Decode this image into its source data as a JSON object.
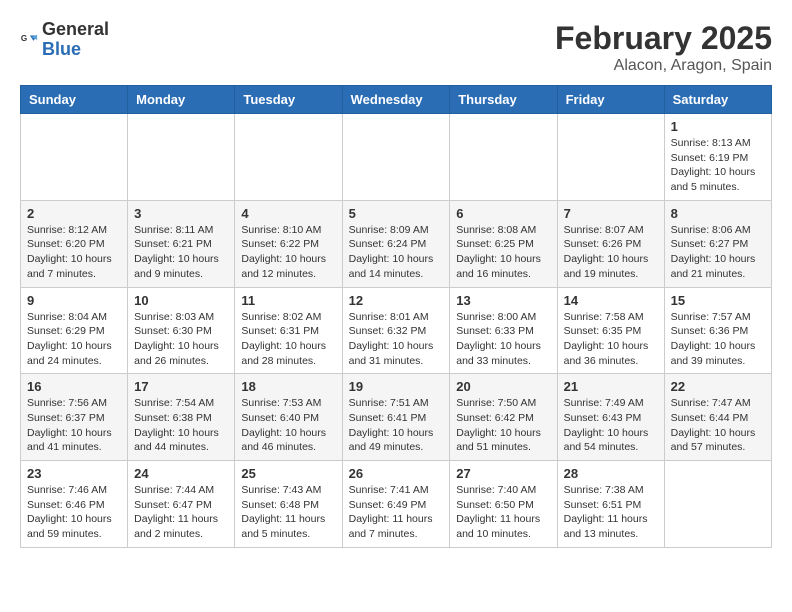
{
  "header": {
    "logo_general": "General",
    "logo_blue": "Blue",
    "month_title": "February 2025",
    "location": "Alacon, Aragon, Spain"
  },
  "days_of_week": [
    "Sunday",
    "Monday",
    "Tuesday",
    "Wednesday",
    "Thursday",
    "Friday",
    "Saturday"
  ],
  "weeks": [
    [
      {
        "day": "",
        "info": ""
      },
      {
        "day": "",
        "info": ""
      },
      {
        "day": "",
        "info": ""
      },
      {
        "day": "",
        "info": ""
      },
      {
        "day": "",
        "info": ""
      },
      {
        "day": "",
        "info": ""
      },
      {
        "day": "1",
        "info": "Sunrise: 8:13 AM\nSunset: 6:19 PM\nDaylight: 10 hours and 5 minutes."
      }
    ],
    [
      {
        "day": "2",
        "info": "Sunrise: 8:12 AM\nSunset: 6:20 PM\nDaylight: 10 hours and 7 minutes."
      },
      {
        "day": "3",
        "info": "Sunrise: 8:11 AM\nSunset: 6:21 PM\nDaylight: 10 hours and 9 minutes."
      },
      {
        "day": "4",
        "info": "Sunrise: 8:10 AM\nSunset: 6:22 PM\nDaylight: 10 hours and 12 minutes."
      },
      {
        "day": "5",
        "info": "Sunrise: 8:09 AM\nSunset: 6:24 PM\nDaylight: 10 hours and 14 minutes."
      },
      {
        "day": "6",
        "info": "Sunrise: 8:08 AM\nSunset: 6:25 PM\nDaylight: 10 hours and 16 minutes."
      },
      {
        "day": "7",
        "info": "Sunrise: 8:07 AM\nSunset: 6:26 PM\nDaylight: 10 hours and 19 minutes."
      },
      {
        "day": "8",
        "info": "Sunrise: 8:06 AM\nSunset: 6:27 PM\nDaylight: 10 hours and 21 minutes."
      }
    ],
    [
      {
        "day": "9",
        "info": "Sunrise: 8:04 AM\nSunset: 6:29 PM\nDaylight: 10 hours and 24 minutes."
      },
      {
        "day": "10",
        "info": "Sunrise: 8:03 AM\nSunset: 6:30 PM\nDaylight: 10 hours and 26 minutes."
      },
      {
        "day": "11",
        "info": "Sunrise: 8:02 AM\nSunset: 6:31 PM\nDaylight: 10 hours and 28 minutes."
      },
      {
        "day": "12",
        "info": "Sunrise: 8:01 AM\nSunset: 6:32 PM\nDaylight: 10 hours and 31 minutes."
      },
      {
        "day": "13",
        "info": "Sunrise: 8:00 AM\nSunset: 6:33 PM\nDaylight: 10 hours and 33 minutes."
      },
      {
        "day": "14",
        "info": "Sunrise: 7:58 AM\nSunset: 6:35 PM\nDaylight: 10 hours and 36 minutes."
      },
      {
        "day": "15",
        "info": "Sunrise: 7:57 AM\nSunset: 6:36 PM\nDaylight: 10 hours and 39 minutes."
      }
    ],
    [
      {
        "day": "16",
        "info": "Sunrise: 7:56 AM\nSunset: 6:37 PM\nDaylight: 10 hours and 41 minutes."
      },
      {
        "day": "17",
        "info": "Sunrise: 7:54 AM\nSunset: 6:38 PM\nDaylight: 10 hours and 44 minutes."
      },
      {
        "day": "18",
        "info": "Sunrise: 7:53 AM\nSunset: 6:40 PM\nDaylight: 10 hours and 46 minutes."
      },
      {
        "day": "19",
        "info": "Sunrise: 7:51 AM\nSunset: 6:41 PM\nDaylight: 10 hours and 49 minutes."
      },
      {
        "day": "20",
        "info": "Sunrise: 7:50 AM\nSunset: 6:42 PM\nDaylight: 10 hours and 51 minutes."
      },
      {
        "day": "21",
        "info": "Sunrise: 7:49 AM\nSunset: 6:43 PM\nDaylight: 10 hours and 54 minutes."
      },
      {
        "day": "22",
        "info": "Sunrise: 7:47 AM\nSunset: 6:44 PM\nDaylight: 10 hours and 57 minutes."
      }
    ],
    [
      {
        "day": "23",
        "info": "Sunrise: 7:46 AM\nSunset: 6:46 PM\nDaylight: 10 hours and 59 minutes."
      },
      {
        "day": "24",
        "info": "Sunrise: 7:44 AM\nSunset: 6:47 PM\nDaylight: 11 hours and 2 minutes."
      },
      {
        "day": "25",
        "info": "Sunrise: 7:43 AM\nSunset: 6:48 PM\nDaylight: 11 hours and 5 minutes."
      },
      {
        "day": "26",
        "info": "Sunrise: 7:41 AM\nSunset: 6:49 PM\nDaylight: 11 hours and 7 minutes."
      },
      {
        "day": "27",
        "info": "Sunrise: 7:40 AM\nSunset: 6:50 PM\nDaylight: 11 hours and 10 minutes."
      },
      {
        "day": "28",
        "info": "Sunrise: 7:38 AM\nSunset: 6:51 PM\nDaylight: 11 hours and 13 minutes."
      },
      {
        "day": "",
        "info": ""
      }
    ]
  ]
}
